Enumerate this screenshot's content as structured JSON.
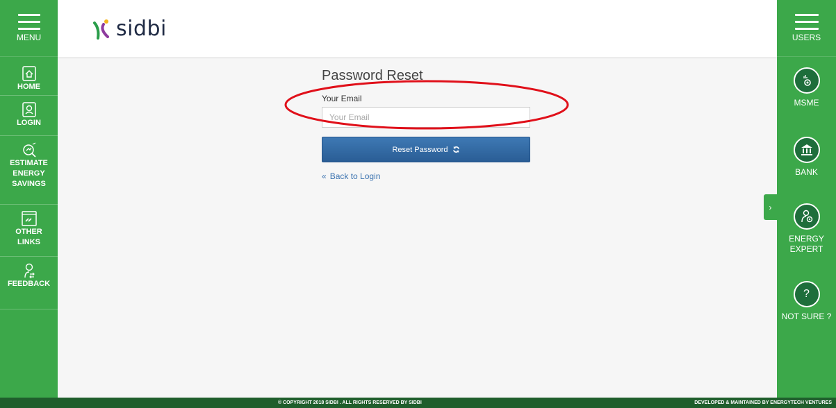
{
  "sidebar": {
    "menu_label": "MENU",
    "items": [
      {
        "label": "HOME",
        "icon": "home-icon"
      },
      {
        "label": "LOGIN",
        "icon": "login-icon"
      },
      {
        "label": "ESTIMATE\nENERGY\nSAVINGS",
        "icon": "estimate-icon"
      },
      {
        "label": "OTHER\nLINKS",
        "icon": "links-icon"
      },
      {
        "label": "FEEDBACK",
        "icon": "feedback-icon"
      }
    ]
  },
  "header": {
    "logo_text": "sidbi"
  },
  "form": {
    "title": "Password Reset",
    "email_label": "Your Email",
    "email_placeholder": "Your Email",
    "email_value": "",
    "reset_label": "Reset Password",
    "back_label": "Back to Login",
    "back_glyph": "«"
  },
  "right_panel": {
    "users_label": "USERS",
    "roles": [
      {
        "label": "MSME",
        "icon": "msme-gear-icon"
      },
      {
        "label": "BANK",
        "icon": "bank-icon"
      },
      {
        "label": "ENERGY\nEXPERT",
        "icon": "energy-expert-icon"
      },
      {
        "label": "NOT SURE ?",
        "icon": "question-icon",
        "glyph": "?"
      }
    ],
    "collapse_glyph": "›"
  },
  "footer": {
    "copyright": "© COPYRIGHT 2018 SIDBI . ALL RIGHTS RESERVED BY SIDBI",
    "developer": "DEVELOPED & MAINTAINED BY ENERGYTECH VENTURES"
  },
  "colors": {
    "sidebar_green": "#3ca84a",
    "footer_green": "#1f5e2c",
    "role_circle": "#1e6e3b",
    "button_blue": "#2f6aa6",
    "link_blue": "#3b73b0",
    "highlight_red": "#e0101a"
  }
}
